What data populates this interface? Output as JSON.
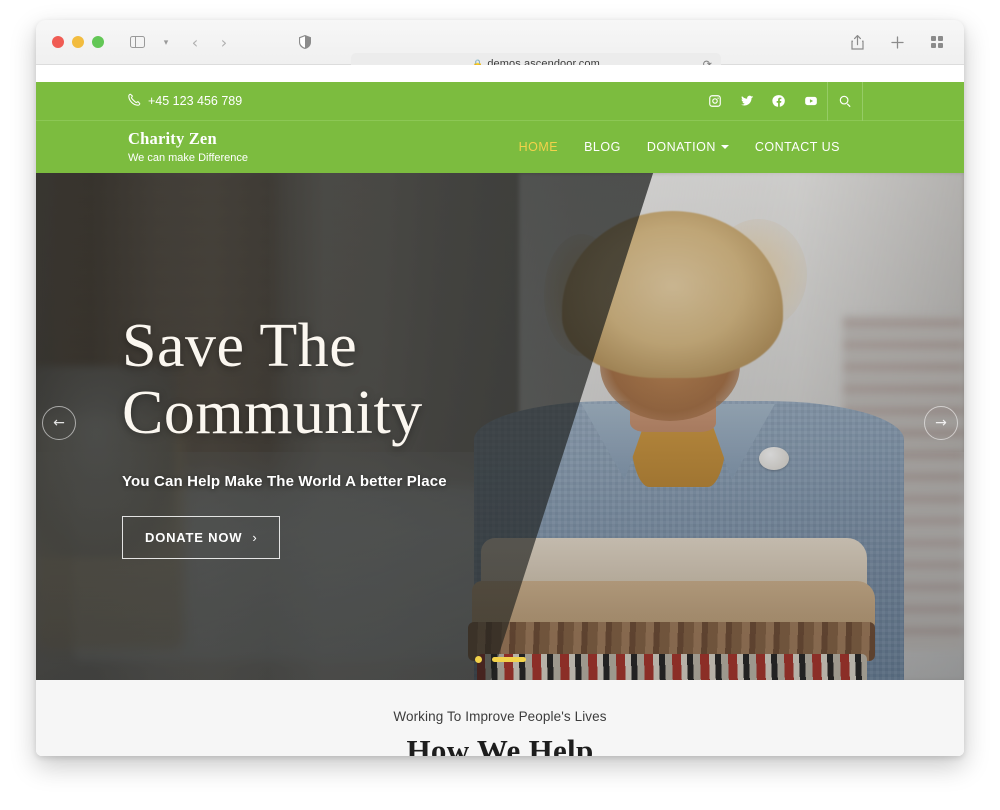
{
  "browser": {
    "url": "demos.ascendoor.com",
    "lock_icon": "lock-icon",
    "reload_icon": "reload-icon",
    "back_icon": "back-arrow-icon",
    "forward_icon": "forward-arrow-icon",
    "sidebar_icon": "sidebar-toggle-icon",
    "shield_icon": "privacy-shield-icon",
    "share_icon": "share-icon",
    "newtab_icon": "new-tab-icon",
    "tabgroup_icon": "tab-overview-icon"
  },
  "topbar": {
    "phone": "+45 123 456 789",
    "phone_icon": "phone-icon",
    "socials": [
      {
        "name": "instagram-icon",
        "label": "Instagram"
      },
      {
        "name": "twitter-icon",
        "label": "Twitter"
      },
      {
        "name": "facebook-icon",
        "label": "Facebook"
      },
      {
        "name": "youtube-icon",
        "label": "YouTube"
      }
    ],
    "search_icon": "search-icon",
    "bg_color": "#7cbc3f"
  },
  "header": {
    "brand_name": "Charity Zen",
    "brand_tagline": "We can make Difference",
    "nav": [
      {
        "label": "HOME",
        "active": true,
        "dropdown": false
      },
      {
        "label": "BLOG",
        "active": false,
        "dropdown": false
      },
      {
        "label": "DONATION",
        "active": false,
        "dropdown": true
      },
      {
        "label": "CONTACT US",
        "active": false,
        "dropdown": false
      }
    ],
    "active_color": "#f2d24a"
  },
  "hero": {
    "title_line1": "Save The",
    "title_line2": "Community",
    "subtitle": "You Can Help Make The World A better Place",
    "cta_label": "DONATE NOW",
    "cta_arrow": "›",
    "prev_icon": "←",
    "next_icon": "→",
    "pagination": {
      "total": 2,
      "active_index": 1,
      "accent_color": "#f2d24a"
    }
  },
  "below_hero": {
    "eyebrow": "Working To Improve People's Lives",
    "heading": "How We Help"
  }
}
